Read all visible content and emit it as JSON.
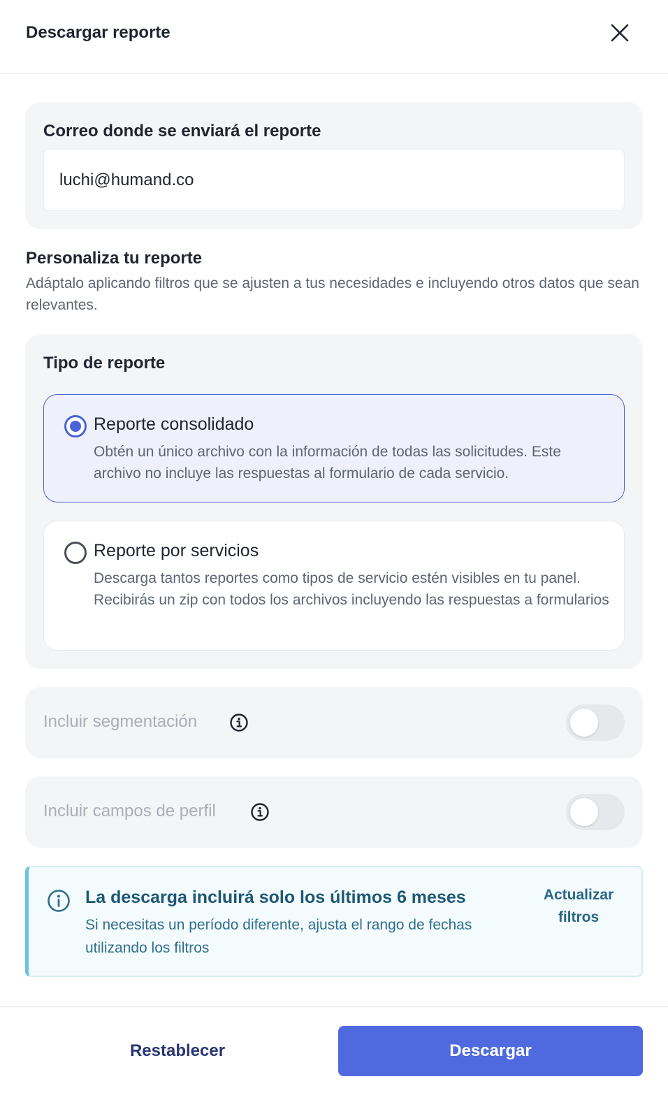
{
  "dialog": {
    "title": "Descargar reporte",
    "close_icon": "close-icon"
  },
  "email": {
    "label": "Correo donde se enviará el reporte",
    "value": "luchi@humand.co"
  },
  "personalize": {
    "title": "Personaliza tu reporte",
    "description": "Adáptalo aplicando filtros que se ajusten a tus necesidades e incluyendo otros datos que sean relevantes."
  },
  "report_type": {
    "label": "Tipo de reporte",
    "selected": "consolidated",
    "options": [
      {
        "id": "consolidated",
        "title": "Reporte consolidado",
        "description": "Obtén un único archivo con la información de todas las solicitudes. Este archivo no incluye las respuestas al formulario de cada servicio."
      },
      {
        "id": "by_service",
        "title": "Reporte por servicios",
        "description": "Descarga tantos reportes como tipos de servicio estén visibles en tu panel. Recibirás un zip con todos los archivos incluyendo las respuestas a formularios"
      }
    ]
  },
  "toggles": {
    "segmentation": {
      "label": "Incluir segmentación",
      "enabled": false,
      "icon": "info-icon"
    },
    "profile_fields": {
      "label": "Incluir campos de perfil",
      "enabled": false,
      "icon": "info-icon"
    }
  },
  "banner": {
    "title": "La descarga incluirá solo los últimos 6 meses",
    "description": "Si necesitas un período diferente, ajusta el rango de fechas utilizando los filtros",
    "link": "Actualizar filtros",
    "icon": "info-circle-icon"
  },
  "footer": {
    "reset_label": "Restablecer",
    "download_label": "Descargar"
  },
  "colors": {
    "primary": "#4f6ade",
    "selected_bg": "#eef1fc",
    "banner_accent": "#6cc4dc",
    "banner_text": "#1d5875",
    "card_bg": "#f4f5f7"
  }
}
